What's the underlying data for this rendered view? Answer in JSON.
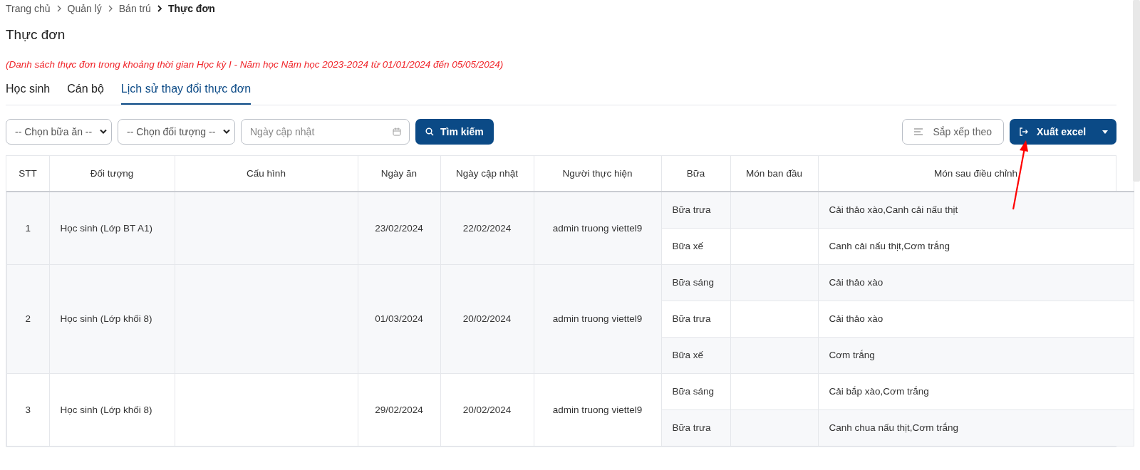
{
  "breadcrumb": [
    {
      "label": "Trang chủ",
      "current": false
    },
    {
      "label": "Quản lý",
      "current": false
    },
    {
      "label": "Bán trú",
      "current": false
    },
    {
      "label": "Thực đơn",
      "current": true
    }
  ],
  "title": "Thực đơn",
  "note": "(Danh sách thực đơn trong khoảng thời gian Học kỳ I - Năm học Năm học 2023-2024 từ 01/01/2024 đến 05/05/2024)",
  "tabs": [
    {
      "label": "Học sinh",
      "selected": false
    },
    {
      "label": "Cán bộ",
      "selected": false
    },
    {
      "label": "Lịch sử thay đổi thực đơn",
      "selected": true
    }
  ],
  "filters": {
    "meal_select": "-- Chọn bữa ăn --",
    "target_select": "-- Chọn đối tượng --",
    "date_field": {
      "placeholder": "Ngày cập nhật"
    },
    "search_button": "Tìm kiếm"
  },
  "actions": {
    "sort_button": "Sắp xếp theo",
    "export_button": "Xuất excel"
  },
  "table": {
    "columns": [
      "STT",
      "Đối tượng",
      "Cấu hình",
      "Ngày ăn",
      "Ngày cập nhật",
      "Người thực hiện",
      "Bữa",
      "Món ban đầu",
      "Món sau điều chỉnh"
    ],
    "rows": [
      {
        "stt": "1",
        "target": "Học sinh (Lớp BT A1)",
        "meal_date": "23/02/2024",
        "updated": "22/02/2024",
        "user": "admin truong viettel9",
        "meals": [
          {
            "meal": "Bữa trưa",
            "after": "Cải thảo xào,Canh cải nấu thịt"
          },
          {
            "meal": "Bữa xế",
            "after": "Canh cải nấu thịt,Cơm trắng"
          }
        ]
      },
      {
        "stt": "2",
        "target": "Học sinh (Lớp khối 8)",
        "meal_date": "01/03/2024",
        "updated": "20/02/2024",
        "user": "admin truong viettel9",
        "meals": [
          {
            "meal": "Bữa sáng",
            "after": "Cải thảo xào"
          },
          {
            "meal": "Bữa trưa",
            "after": "Cải thảo xào"
          },
          {
            "meal": "Bữa xế",
            "after": "Cơm trắng"
          }
        ]
      },
      {
        "stt": "3",
        "target": "Học sinh (Lớp khối 8)",
        "meal_date": "29/02/2024",
        "updated": "20/02/2024",
        "user": "admin truong viettel9",
        "meals": [
          {
            "meal": "Bữa sáng",
            "after": "Cải bắp xào,Cơm trắng"
          },
          {
            "meal": "Bữa trưa",
            "after": "Canh chua nấu thịt,Cơm trắng"
          }
        ]
      }
    ]
  }
}
